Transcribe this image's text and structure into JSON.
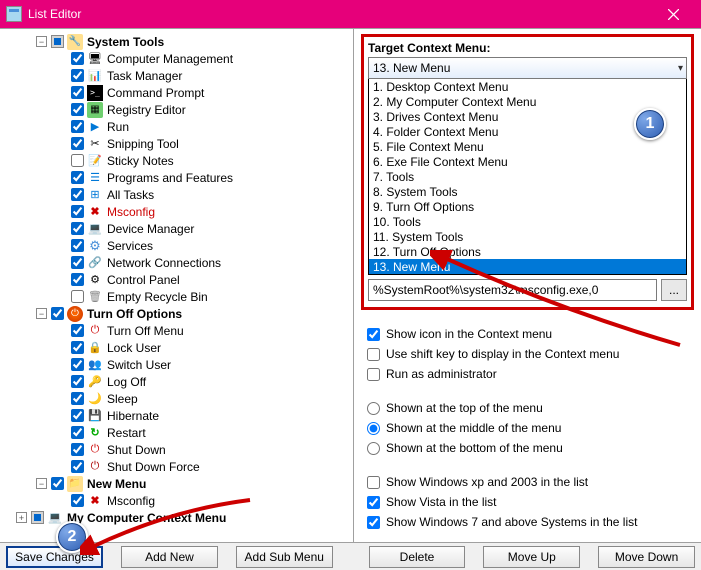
{
  "window": {
    "title": "List Editor"
  },
  "tree": {
    "nodes": [
      {
        "depth": 1,
        "exp": "-",
        "chk": "ind",
        "icon": "ic-tools",
        "label": "System Tools",
        "bold": true
      },
      {
        "depth": 2,
        "chk": true,
        "icon": "ic-pc",
        "label": "Computer Management"
      },
      {
        "depth": 2,
        "chk": true,
        "icon": "ic-tm",
        "label": "Task Manager"
      },
      {
        "depth": 2,
        "chk": true,
        "icon": "ic-cmd",
        "label": "Command Prompt"
      },
      {
        "depth": 2,
        "chk": true,
        "icon": "ic-reg",
        "label": "Registry Editor"
      },
      {
        "depth": 2,
        "chk": true,
        "icon": "ic-run",
        "label": "Run"
      },
      {
        "depth": 2,
        "chk": true,
        "icon": "ic-snip",
        "label": "Snipping Tool"
      },
      {
        "depth": 2,
        "chk": false,
        "icon": "ic-note",
        "label": "Sticky Notes"
      },
      {
        "depth": 2,
        "chk": true,
        "icon": "ic-prog",
        "label": "Programs and Features"
      },
      {
        "depth": 2,
        "chk": true,
        "icon": "ic-all",
        "label": "All Tasks"
      },
      {
        "depth": 2,
        "chk": true,
        "icon": "ic-x",
        "label": "Msconfig",
        "red": true
      },
      {
        "depth": 2,
        "chk": true,
        "icon": "ic-dev",
        "label": "Device Manager"
      },
      {
        "depth": 2,
        "chk": true,
        "icon": "ic-svc",
        "label": "Services"
      },
      {
        "depth": 2,
        "chk": true,
        "icon": "ic-net",
        "label": "Network Connections"
      },
      {
        "depth": 2,
        "chk": true,
        "icon": "ic-cp",
        "label": "Control Panel"
      },
      {
        "depth": 2,
        "chk": false,
        "icon": "ic-bin",
        "label": "Empty Recycle Bin"
      },
      {
        "depth": 1,
        "exp": "-",
        "chk": true,
        "icon": "ic-power",
        "label": "Turn Off Options",
        "bold": true
      },
      {
        "depth": 2,
        "chk": true,
        "icon": "ic-turn",
        "label": "Turn Off Menu"
      },
      {
        "depth": 2,
        "chk": true,
        "icon": "ic-lock",
        "label": "Lock User"
      },
      {
        "depth": 2,
        "chk": true,
        "icon": "ic-su",
        "label": "Switch User"
      },
      {
        "depth": 2,
        "chk": true,
        "icon": "ic-logoff",
        "label": "Log Off"
      },
      {
        "depth": 2,
        "chk": true,
        "icon": "ic-sleep",
        "label": "Sleep"
      },
      {
        "depth": 2,
        "chk": true,
        "icon": "ic-hib",
        "label": "Hibernate"
      },
      {
        "depth": 2,
        "chk": true,
        "icon": "ic-restart",
        "label": "Restart"
      },
      {
        "depth": 2,
        "chk": true,
        "icon": "ic-sd",
        "label": "Shut Down"
      },
      {
        "depth": 2,
        "chk": true,
        "icon": "ic-sdf",
        "label": "Shut Down Force"
      },
      {
        "depth": 1,
        "exp": "-",
        "chk": true,
        "icon": "ic-folder",
        "label": "New Menu",
        "bold": true
      },
      {
        "depth": 2,
        "chk": true,
        "icon": "ic-x",
        "label": "Msconfig"
      },
      {
        "depth": 0,
        "exp": "+",
        "chk": "ind",
        "icon": "ic-mypc",
        "label": "My Computer Context Menu",
        "bold": true
      }
    ]
  },
  "target": {
    "label": "Target Context Menu:",
    "selected": "13. New Menu",
    "options": [
      "1. Desktop Context Menu",
      "2. My Computer Context Menu",
      "3. Drives Context Menu",
      "4. Folder Context Menu",
      "5. File Context Menu",
      "6. Exe File Context Menu",
      "7. Tools",
      "8. System Tools",
      "9. Turn Off Options",
      "10. Tools",
      "11. System Tools",
      "12. Turn Off Options",
      "13. New Menu"
    ],
    "path": "%SystemRoot%\\system32\\msconfig.exe,0",
    "browse": "..."
  },
  "opts": {
    "show_icon": {
      "label": "Show icon in the Context menu",
      "checked": true
    },
    "use_shift": {
      "label": "Use shift key to display in the Context menu",
      "checked": false
    },
    "run_admin": {
      "label": "Run as administrator",
      "checked": false
    },
    "pos_top": {
      "label": "Shown at the top of the menu"
    },
    "pos_mid": {
      "label": "Shown at the middle of the menu"
    },
    "pos_bot": {
      "label": "Shown at the bottom of the menu"
    },
    "pos_selected": "mid",
    "show_xp": {
      "label": "Show Windows xp  and 2003 in the list",
      "checked": false
    },
    "show_vista": {
      "label": "Show Vista in the list",
      "checked": true
    },
    "show_win7": {
      "label": "Show Windows 7 and above Systems in the list",
      "checked": true
    }
  },
  "buttons": {
    "save": "Save Changes",
    "addnew": "Add New",
    "addsub": "Add Sub Menu",
    "delete": "Delete",
    "moveup": "Move Up",
    "movedown": "Move Down"
  },
  "annotations": {
    "badge1": "1",
    "badge2": "2"
  }
}
